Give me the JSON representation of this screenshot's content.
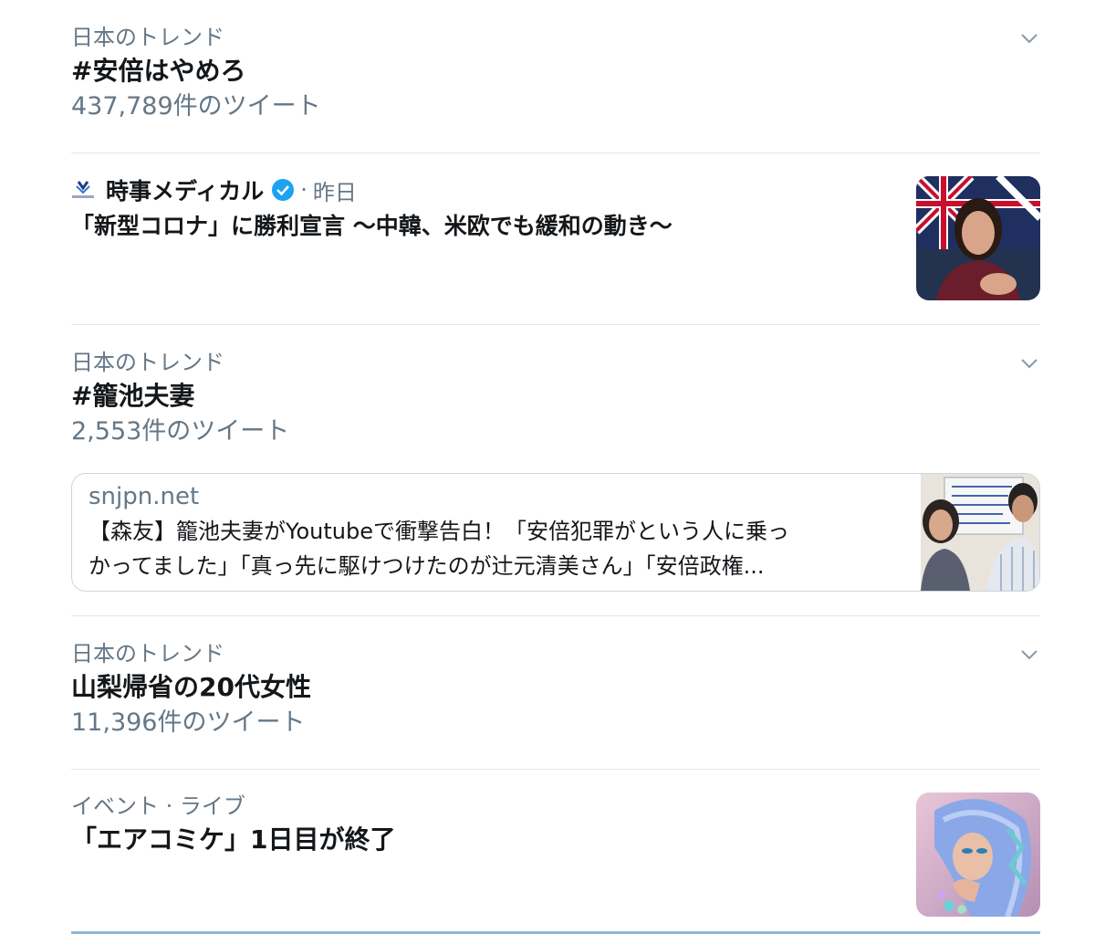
{
  "trends": [
    {
      "category": "日本のトレンド",
      "title": "#安倍はやめろ",
      "count": "437,789件のツイート"
    },
    {
      "category": "日本のトレンド",
      "title": "#籠池夫妻",
      "count": "2,553件のツイート"
    },
    {
      "category": "日本のトレンド",
      "title": "山梨帰省の20代女性",
      "count": "11,396件のツイート"
    }
  ],
  "news": {
    "source": "時事メディカル",
    "separator": "·",
    "time": "昨日",
    "headline": "「新型コロナ」に勝利宣言 〜中韓、米欧でも緩和の動き〜"
  },
  "link_card": {
    "domain": "snjpn.net",
    "line1": "【森友】籠池夫妻がYoutubeで衝撃告白！「安倍犯罪がという人に乗っ",
    "line2": "かってました」「真っ先に駆けつけたのが辻元清美さん」「安倍政権..."
  },
  "event": {
    "category": "イベント · ライブ",
    "title": "「エアコミケ」1日目が終了"
  },
  "icons": {
    "chevron": "chevron-down-icon",
    "verified": "verified-badge-icon",
    "source_logo": "source-logo-icon"
  },
  "colors": {
    "secondary_text": "#657786",
    "divider": "#e1e8ed",
    "verified_blue": "#1da1f2"
  }
}
